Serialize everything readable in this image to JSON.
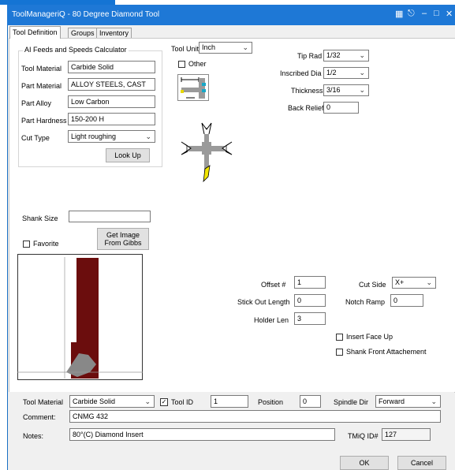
{
  "window": {
    "title": "ToolManageriQ - 80 Degree Diamond Tool",
    "icons": [
      "window-icon",
      "pin-icon",
      "minimize-icon",
      "maximize-icon",
      "close-icon"
    ]
  },
  "tabs": [
    {
      "label": "Tool Definition",
      "active": true
    },
    {
      "label": "Groups",
      "active": false
    },
    {
      "label": "Inventory",
      "active": false
    }
  ],
  "feeds": {
    "group_title": "AI Feeds and Speeds Calculator",
    "tool_material_label": "Tool Material",
    "tool_material_value": "Carbide Solid",
    "part_material_label": "Part Material",
    "part_material_value": "ALLOY STEELS, CAST",
    "part_alloy_label": "Part Alloy",
    "part_alloy_value": "Low Carbon",
    "part_hardness_label": "Part Hardness",
    "part_hardness_value": "150-200  H",
    "cut_type_label": "Cut Type",
    "cut_type_value": "Light roughing",
    "look_up_label": "Look Up"
  },
  "tool_unit": {
    "label": "Tool Unit",
    "value": "Inch",
    "other_label": "Other"
  },
  "insert": {
    "tip_rad_label": "Tip Rad",
    "tip_rad_value": "1/32",
    "inscribed_dia_label": "Inscribed Dia",
    "inscribed_dia_value": "1/2",
    "thickness_label": "Thickness",
    "thickness_value": "3/16",
    "back_relief_label": "Back Relief",
    "back_relief_value": "0"
  },
  "shank": {
    "shank_size_label": "Shank Size",
    "shank_size_value": "",
    "favorite_label": "Favorite",
    "get_image_label_1": "Get Image",
    "get_image_label_2": "From Gibbs"
  },
  "offsets": {
    "offset_label": "Offset #",
    "offset_value": "1",
    "stick_out_label": "Stick Out Length",
    "stick_out_value": "0",
    "holder_len_label": "Holder Len",
    "holder_len_value": "3",
    "cut_side_label": "Cut Side",
    "cut_side_value": "X+",
    "notch_ramp_label": "Notch Ramp",
    "notch_ramp_value": "0",
    "insert_face_up_label": "Insert Face Up",
    "shank_front_label": "Shank Front Attachement"
  },
  "footer": {
    "tool_material_label": "Tool Material",
    "tool_material_value": "Carbide Solid",
    "tool_id_label": "Tool ID",
    "tool_id_value": "1",
    "position_label": "Position",
    "position_value": "0",
    "spindle_dir_label": "Spindle Dir",
    "spindle_dir_value": "Forward",
    "comment_label": "Comment:",
    "comment_value": "CNMG 432",
    "notes_label": "Notes:",
    "notes_value": "80°(C) Diamond Insert",
    "tmiq_label": "TMiQ ID#",
    "tmiq_value": "127",
    "ok_label": "OK",
    "cancel_label": "Cancel"
  },
  "colors": {
    "titlebar": "#1e78d6",
    "tool_body": "#6b0d0d",
    "insert_yellow": "#f2e600"
  }
}
